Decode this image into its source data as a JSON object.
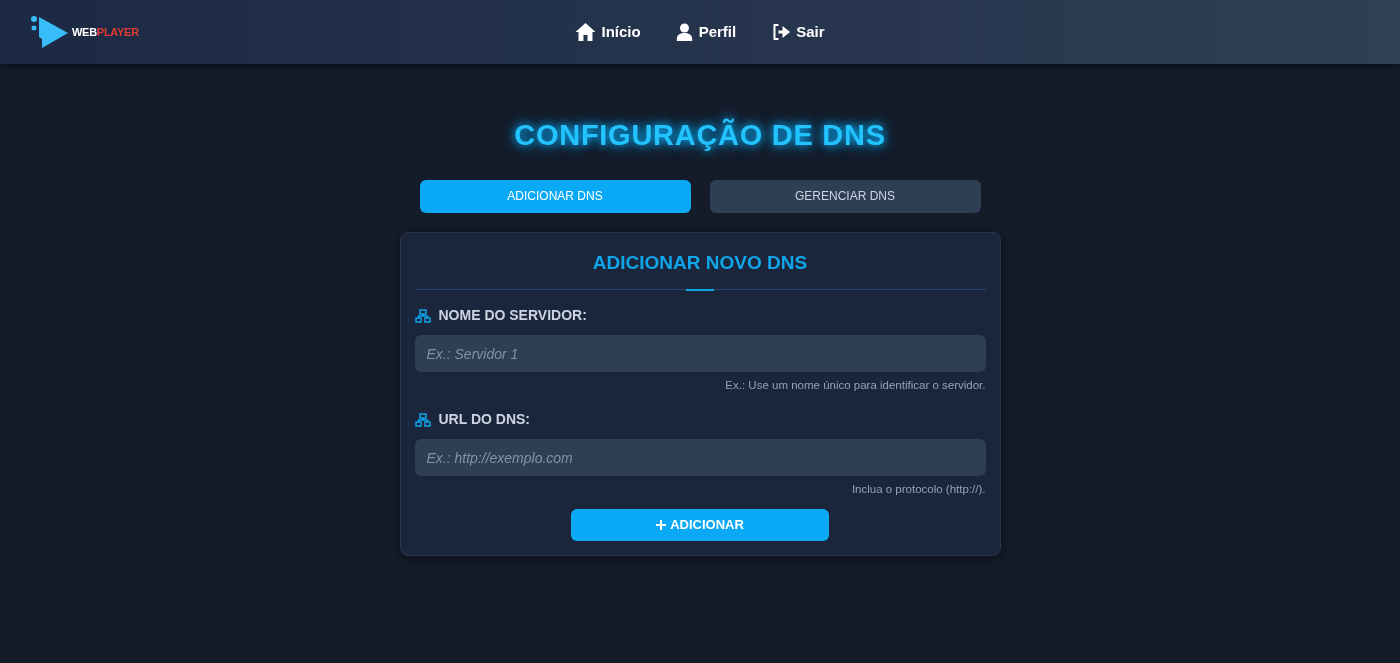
{
  "header": {
    "logo": {
      "first": "WEB",
      "second": "PLAYER"
    },
    "nav": [
      {
        "kind": "home",
        "label": "Início"
      },
      {
        "kind": "user",
        "label": "Perfil"
      },
      {
        "kind": "logout",
        "label": "Sair"
      }
    ]
  },
  "title": "CONFIGURAÇÃO DE DNS",
  "tabs": [
    {
      "label": "ADICIONAR DNS",
      "selected": true
    },
    {
      "label": "GERENCIAR DNS",
      "selected": false
    }
  ],
  "card": {
    "title": "ADICIONAR NOVO DNS",
    "fields": [
      {
        "label": "NOME DO SERVIDOR:",
        "placeholder": "Ex.: Servidor 1",
        "hint": "Ex.: Use um nome único para identificar o servidor."
      },
      {
        "label": "URL DO DNS:",
        "placeholder": "Ex.: http://exemplo.com",
        "hint": "Inclua o protocolo (http://)."
      }
    ],
    "submit": "ADICIONAR"
  }
}
